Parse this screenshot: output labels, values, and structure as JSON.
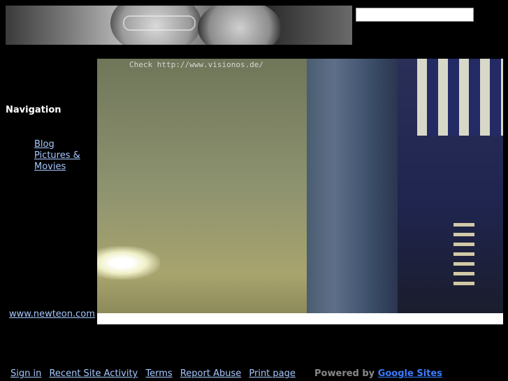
{
  "header": {
    "search": {
      "value": "",
      "placeholder": ""
    }
  },
  "nav": {
    "heading": "Navigation",
    "items": [
      {
        "label": "Blog"
      },
      {
        "label": "Pictures & Movies"
      }
    ]
  },
  "sidebar": {
    "link": "www.newteon.com"
  },
  "main": {
    "image_caption": "Check http://www.visionos.de/"
  },
  "footer": {
    "links": [
      "Sign in",
      "Recent Site Activity",
      "Terms",
      "Report Abuse",
      "Print page"
    ],
    "powered_by": "Powered by",
    "powered_link": "Google Sites"
  },
  "colors": {
    "background": "#000000",
    "link": "#a6c8ff",
    "powered_link": "#3b7cff"
  }
}
